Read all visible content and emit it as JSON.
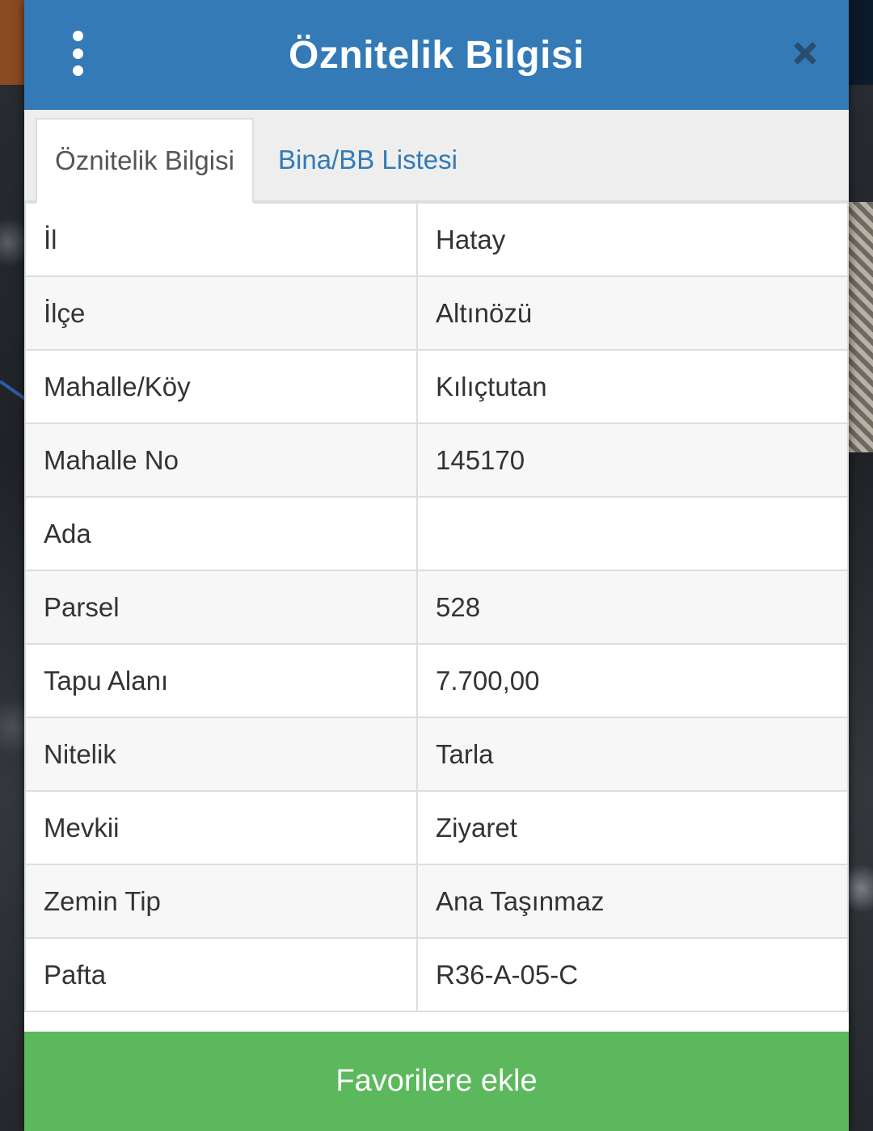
{
  "header": {
    "title": "Öznitelik Bilgisi"
  },
  "tabs": [
    {
      "label": "Öznitelik Bilgisi",
      "active": true
    },
    {
      "label": "Bina/BB Listesi",
      "active": false
    }
  ],
  "attributes": [
    {
      "key": "İl",
      "value": "Hatay"
    },
    {
      "key": "İlçe",
      "value": "Altınözü"
    },
    {
      "key": "Mahalle/Köy",
      "value": "Kılıçtutan"
    },
    {
      "key": "Mahalle No",
      "value": "145170"
    },
    {
      "key": "Ada",
      "value": ""
    },
    {
      "key": "Parsel",
      "value": "528"
    },
    {
      "key": "Tapu Alanı",
      "value": "7.700,00"
    },
    {
      "key": "Nitelik",
      "value": "Tarla"
    },
    {
      "key": "Mevkii",
      "value": "Ziyaret"
    },
    {
      "key": "Zemin Tip",
      "value": "Ana Taşınmaz"
    },
    {
      "key": "Pafta",
      "value": "R36-A-05-C"
    }
  ],
  "footer": {
    "favorite_label": "Favorilere ekle"
  },
  "colors": {
    "header_bg": "#337ab7",
    "tab_link": "#337ab7",
    "favorite_bg": "#5cb85c",
    "close_icon": "#2a4d6e"
  },
  "icons": {
    "menu": "kebab-menu-icon",
    "close": "close-icon"
  }
}
